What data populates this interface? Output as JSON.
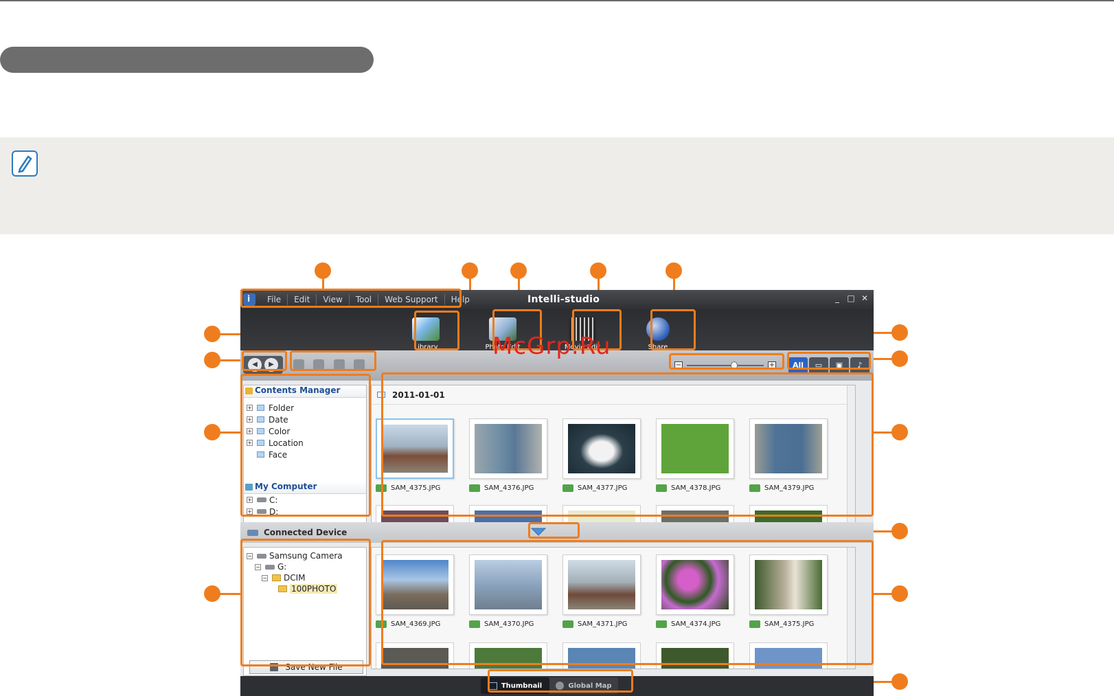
{
  "app": {
    "menu": [
      "File",
      "Edit",
      "View",
      "Tool",
      "Web Support",
      "Help"
    ],
    "title": "Intelli-studio",
    "window_controls": [
      "_",
      "□",
      "✕"
    ]
  },
  "modes": [
    {
      "label": "Library",
      "icon": "library-icon"
    },
    {
      "label": "Photo Edit",
      "icon": "photo-edit-icon"
    },
    {
      "label": "Movie Edit",
      "icon": "movie-edit-icon"
    },
    {
      "label": "Share",
      "icon": "share-globe-icon"
    }
  ],
  "filters": [
    {
      "label": "All",
      "active": true
    },
    {
      "label": "",
      "icon": "video-filter-icon"
    },
    {
      "label": "",
      "icon": "photo-filter-icon"
    },
    {
      "label": "",
      "icon": "voice-filter-icon"
    }
  ],
  "zoom": {
    "level": 0.62
  },
  "contents_manager": {
    "title": "Contents Manager",
    "items": [
      "Folder",
      "Date",
      "Color",
      "Location",
      "Face"
    ]
  },
  "my_computer": {
    "title": "My Computer",
    "drives": [
      "C:",
      "D:"
    ]
  },
  "library_view": {
    "date": "2011-01-01",
    "files": [
      "SAM_4375.JPG",
      "SAM_4376.JPG",
      "SAM_4377.JPG",
      "SAM_4378.JPG",
      "SAM_4379.JPG"
    ]
  },
  "connected_device": {
    "label": "Connected Device",
    "tree": [
      "Samsung Camera",
      "G:",
      "DCIM",
      "100PHOTO"
    ],
    "save_label": "Save New File",
    "files": [
      "SAM_4369.JPG",
      "SAM_4370.JPG",
      "SAM_4371.JPG",
      "SAM_4374.JPG",
      "SAM_4375.JPG"
    ]
  },
  "view_tabs": [
    "Thumbnail",
    "Global Map"
  ],
  "watermark": "McGrp.Ru",
  "colors": {
    "callout": "#ef7d1d",
    "accent": "#2d62c2",
    "watermark": "#e3271d"
  }
}
